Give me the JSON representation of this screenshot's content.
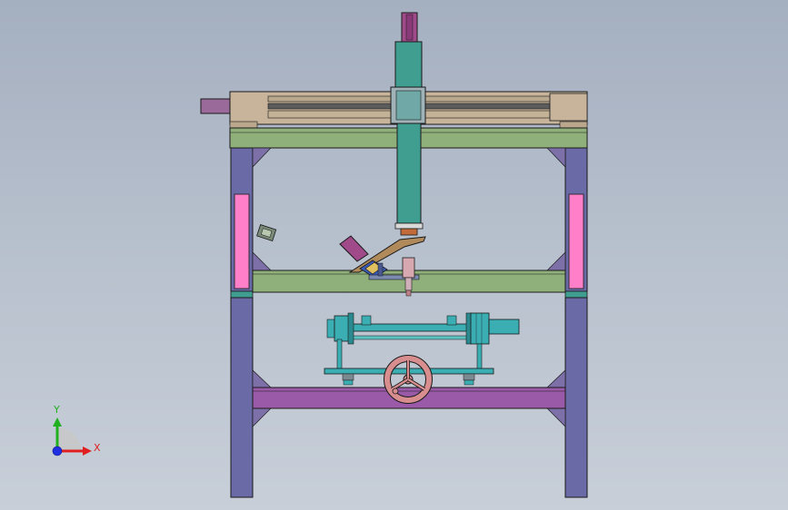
{
  "viewport": {
    "background_top": "#a4afc0",
    "background_bottom": "#c8cfd9"
  },
  "colors": {
    "frame_column": "#6a6aa6",
    "frame_highlight": "#ff7fc8",
    "frame_beam": "#8fb07a",
    "lower_beam": "#9a5aa8",
    "gantry_rail": "#c8b49a",
    "vertical_column": "#3f9e90",
    "spindle_guard": "#a04a8a",
    "motor": "#3aaeb2",
    "handwheel": "#d88e8e",
    "bracket": "#b08a5a",
    "outline": "#1a1a1a"
  },
  "icons": {
    "triad": "coordinate-triad-icon",
    "handwheel": "handwheel-icon"
  },
  "triad": {
    "x_label": "X",
    "y_label": "Y",
    "x_color": "#e02020",
    "y_color": "#20b020",
    "z_color": "#2030e0"
  }
}
